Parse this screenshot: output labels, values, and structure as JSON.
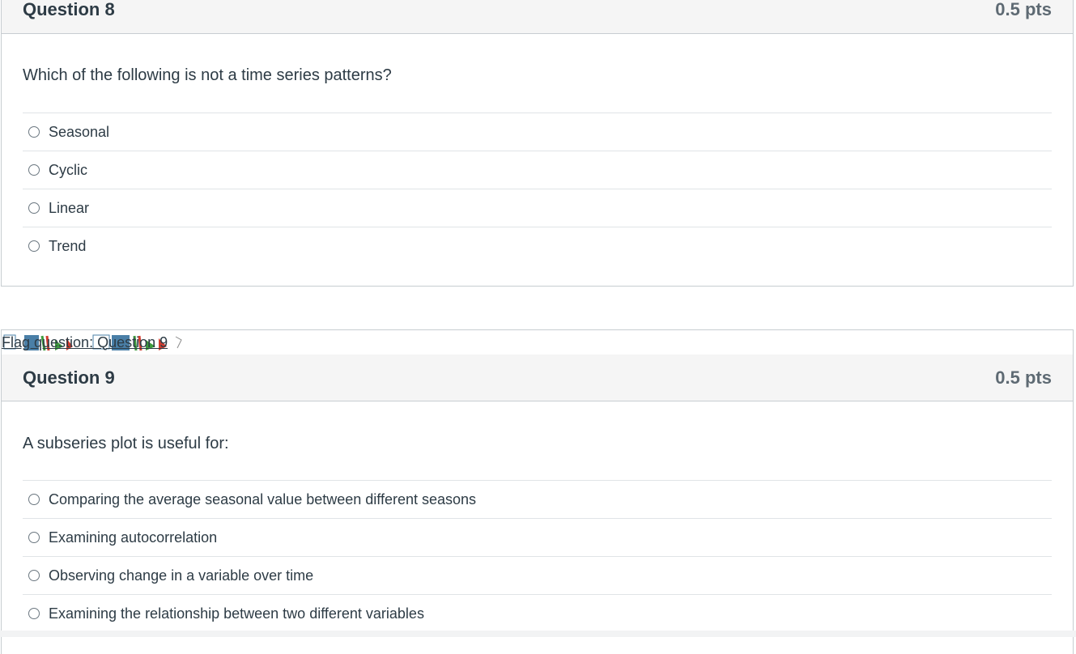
{
  "questions": [
    {
      "title": "Question 8",
      "points": "0.5 pts",
      "text": "Which of the following is not a time series patterns?",
      "options": [
        "Seasonal",
        "Cyclic",
        "Linear",
        "Trend"
      ]
    },
    {
      "title": "Question 9",
      "points": "0.5 pts",
      "text": "A subseries plot is useful for:",
      "options": [
        "Comparing the average seasonal value between different seasons",
        "Examining autocorrelation",
        "Observing change in a variable over time",
        "Examining the relationship between two different variables"
      ]
    }
  ],
  "flag": {
    "label": "Flag question: Question 9",
    "colors": {
      "blue": "#4a7fa7",
      "green": "#3e9b3e",
      "red": "#d13c2f"
    }
  }
}
